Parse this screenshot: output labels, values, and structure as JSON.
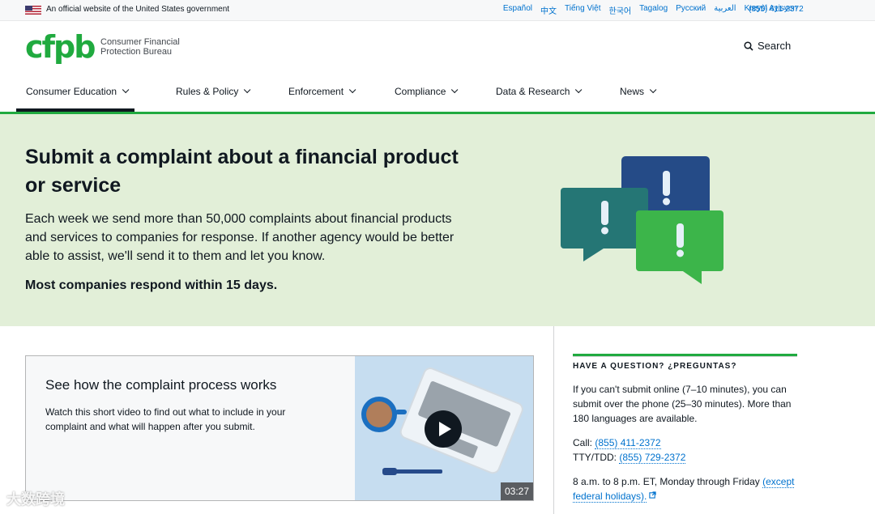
{
  "banner": {
    "official_text": "An official website of the United States government",
    "languages": [
      "Español",
      "中文",
      "Tiếng Việt",
      "한국어",
      "Tagalog",
      "Русский",
      "العربية",
      "Kreyòl Ayisyen"
    ],
    "phone": "(855) 411-2372"
  },
  "header": {
    "logo_mark": "cfpb",
    "logo_line1": "Consumer Financial",
    "logo_line2": "Protection Bureau",
    "search_label": "Search"
  },
  "nav": {
    "items": [
      {
        "label": "Consumer Education",
        "active": true
      },
      {
        "label": "Rules & Policy"
      },
      {
        "label": "Enforcement"
      },
      {
        "label": "Compliance"
      },
      {
        "label": "Data & Research"
      },
      {
        "label": "News"
      }
    ]
  },
  "hero": {
    "title": "Submit a complaint about a financial product or service",
    "description": "Each week we send more than 50,000 complaints about financial products and services to companies for response. If another agency would be better able to assist, we'll send it to them and let you know.",
    "emphasis": "Most companies respond within 15 days."
  },
  "video": {
    "title": "See how the complaint process works",
    "description": "Watch this short video to find out what to include in your complaint and what will happen after you submit.",
    "duration": "03:27"
  },
  "aside": {
    "heading": "HAVE A QUESTION? ¿PREGUNTAS?",
    "body": "If you can't submit online (7–10 minutes), you can submit over the phone (25–30 minutes). More than 180 languages are available.",
    "call_label": "Call:",
    "call_number": "(855) 411-2372",
    "tty_label": "TTY/TDD:",
    "tty_number": "(855) 729-2372",
    "hours_text": "8 a.m. to 8 p.m. ET, Monday through Friday",
    "hours_link": "(except federal holidays)."
  },
  "watermark": "大数跨境",
  "colors": {
    "brand_green": "#20aa3f",
    "hero_bg": "#e2efd8",
    "link_blue": "#0072ce",
    "bubble_teal": "#257675",
    "bubble_navy": "#254b87",
    "bubble_green": "#20aa3f"
  }
}
